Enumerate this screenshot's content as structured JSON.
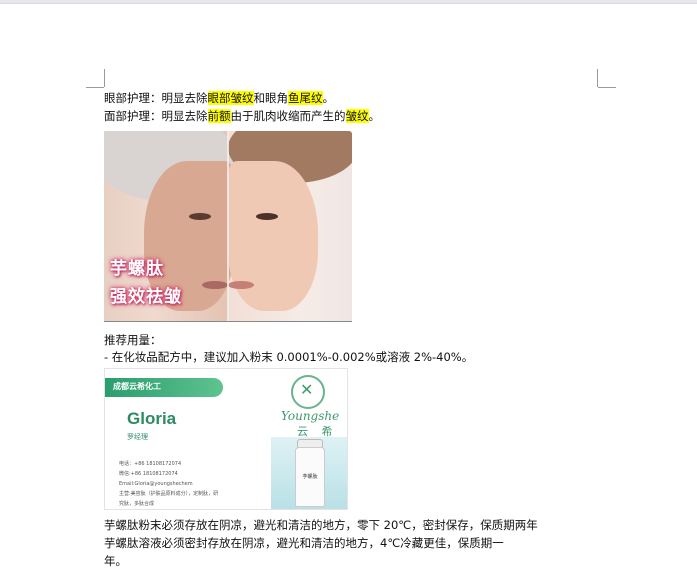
{
  "doc": {
    "line1": {
      "pre": "眼部护理：明显去除",
      "hl1": "眼部皱纹",
      "mid": "和眼角",
      "hl2": "鱼尾纹",
      "post": "。"
    },
    "line2": {
      "pre": "面部护理：明显去除",
      "hl1": "前额",
      "mid": "由于肌肉收缩而产生的",
      "hl2": "皱纹",
      "post": "。"
    },
    "face_image": {
      "line1": "芋螺肽",
      "line2": "强效祛皱"
    },
    "dosage_title": "推荐用量：",
    "dosage_line": "- 在化妆品配方中，建议加入粉末 0.0001%-0.002%或溶液 2%-40%。",
    "storage_line1": "芋螺肽粉末必须存放在阴凉，避光和清洁的地方，零下 20℃，密封保存，保质期两年",
    "storage_line2": "芋螺肽溶液必须密封存放在阴凉，避光和清洁的地方，4℃冷藏更佳，保质期一",
    "storage_line3": "年。"
  },
  "card": {
    "company": "成都云希化工",
    "name": "Gloria",
    "title": "罗经理",
    "info": [
      "电话：+86 18108172074",
      "微信:+86 18108172074",
      "Email:Gloria@youngshechem",
      "主营:美容肽（护肤品原料成分），定制肽，研",
      "究肽，多肽合成"
    ],
    "brand": "Youngshe",
    "brand_cn": "云 希",
    "product_label": "芋螺肽"
  }
}
